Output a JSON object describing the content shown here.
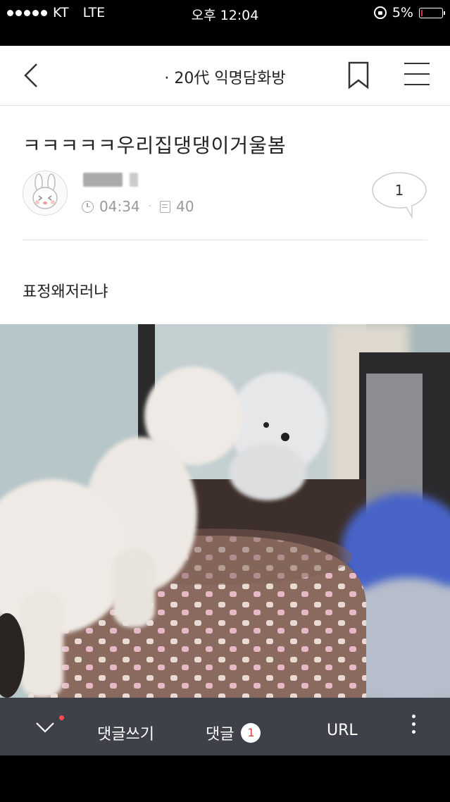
{
  "status_bar": {
    "carrier": "KT",
    "network": "LTE",
    "time": "오후 12:04",
    "battery_percent": "5%",
    "battery_level": 0.05,
    "battery_color": "#e33333"
  },
  "nav": {
    "title": "· 20代 익명담화방",
    "back_icon": "chevron-left-icon",
    "bookmark_icon": "bookmark-icon",
    "menu_icon": "hamburger-menu-icon"
  },
  "post": {
    "title": "ㅋㅋㅋㅋㅋ우리집댕댕이거울봄",
    "time": "04:34",
    "views": "40",
    "comment_count": "1",
    "body": "표정왜저러냐",
    "avatar_icon": "bunny-avatar-icon"
  },
  "bottom_bar": {
    "write_comment": "댓글쓰기",
    "comments_label": "댓글",
    "comments_badge": "1",
    "url_label": "URL",
    "notification_dot_color": "#ff4d4d",
    "background_color": "#3e4149"
  }
}
